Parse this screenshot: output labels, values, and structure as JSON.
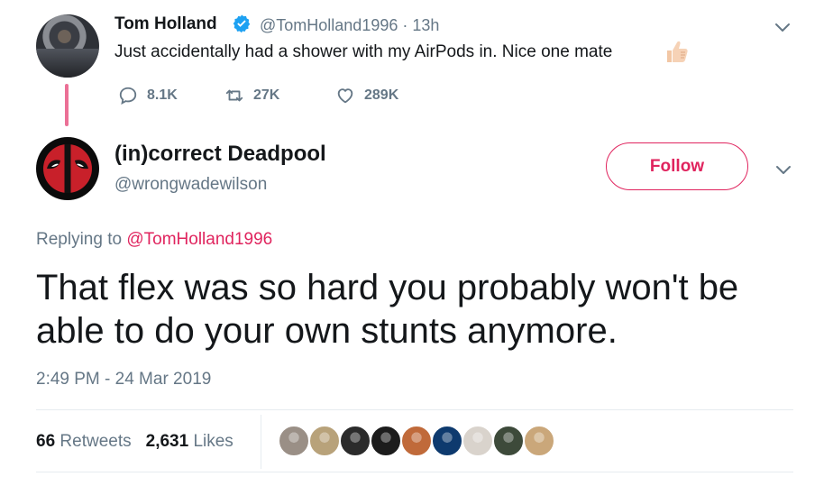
{
  "parent_tweet": {
    "name": "Tom Holland",
    "handle": "@TomHolland1996",
    "time": "13h",
    "text": "Just accidentally had a shower with my AirPods in. Nice one mate",
    "reply_count": "8.1K",
    "retweet_count": "27K",
    "like_count": "289K",
    "colors": {
      "verified": "#1da1f2",
      "thread_line": "#e0245e"
    }
  },
  "reply_tweet": {
    "name": "(in)correct Deadpool",
    "handle": "@wrongwadewilson",
    "follow_label": "Follow",
    "replying_prefix": "Replying to ",
    "replying_mention": "@TomHolland1996",
    "text": "That flex was so hard you probably won't be able to do your own stunts anymore.",
    "timestamp": "2:49 PM - 24 Mar 2019",
    "retweets_count": "66",
    "retweets_label": "Retweets",
    "likes_count": "2,631",
    "likes_label": "Likes",
    "colors": {
      "accent": "#e0245e",
      "text": "#14171a",
      "muted": "#657786"
    }
  },
  "likers": [
    {
      "icon": "liker-avatar",
      "color": "#9a8f86"
    },
    {
      "icon": "liker-avatar",
      "color": "#b8a27a"
    },
    {
      "icon": "liker-avatar",
      "color": "#2b2b2b"
    },
    {
      "icon": "liker-avatar",
      "color": "#1c1c1c"
    },
    {
      "icon": "liker-avatar",
      "color": "#c06a3a"
    },
    {
      "icon": "liker-avatar",
      "color": "#0e3a6e"
    },
    {
      "icon": "liker-avatar",
      "color": "#d9d3cc"
    },
    {
      "icon": "liker-avatar",
      "color": "#3d4a3a"
    },
    {
      "icon": "liker-avatar",
      "color": "#caa77a"
    }
  ]
}
